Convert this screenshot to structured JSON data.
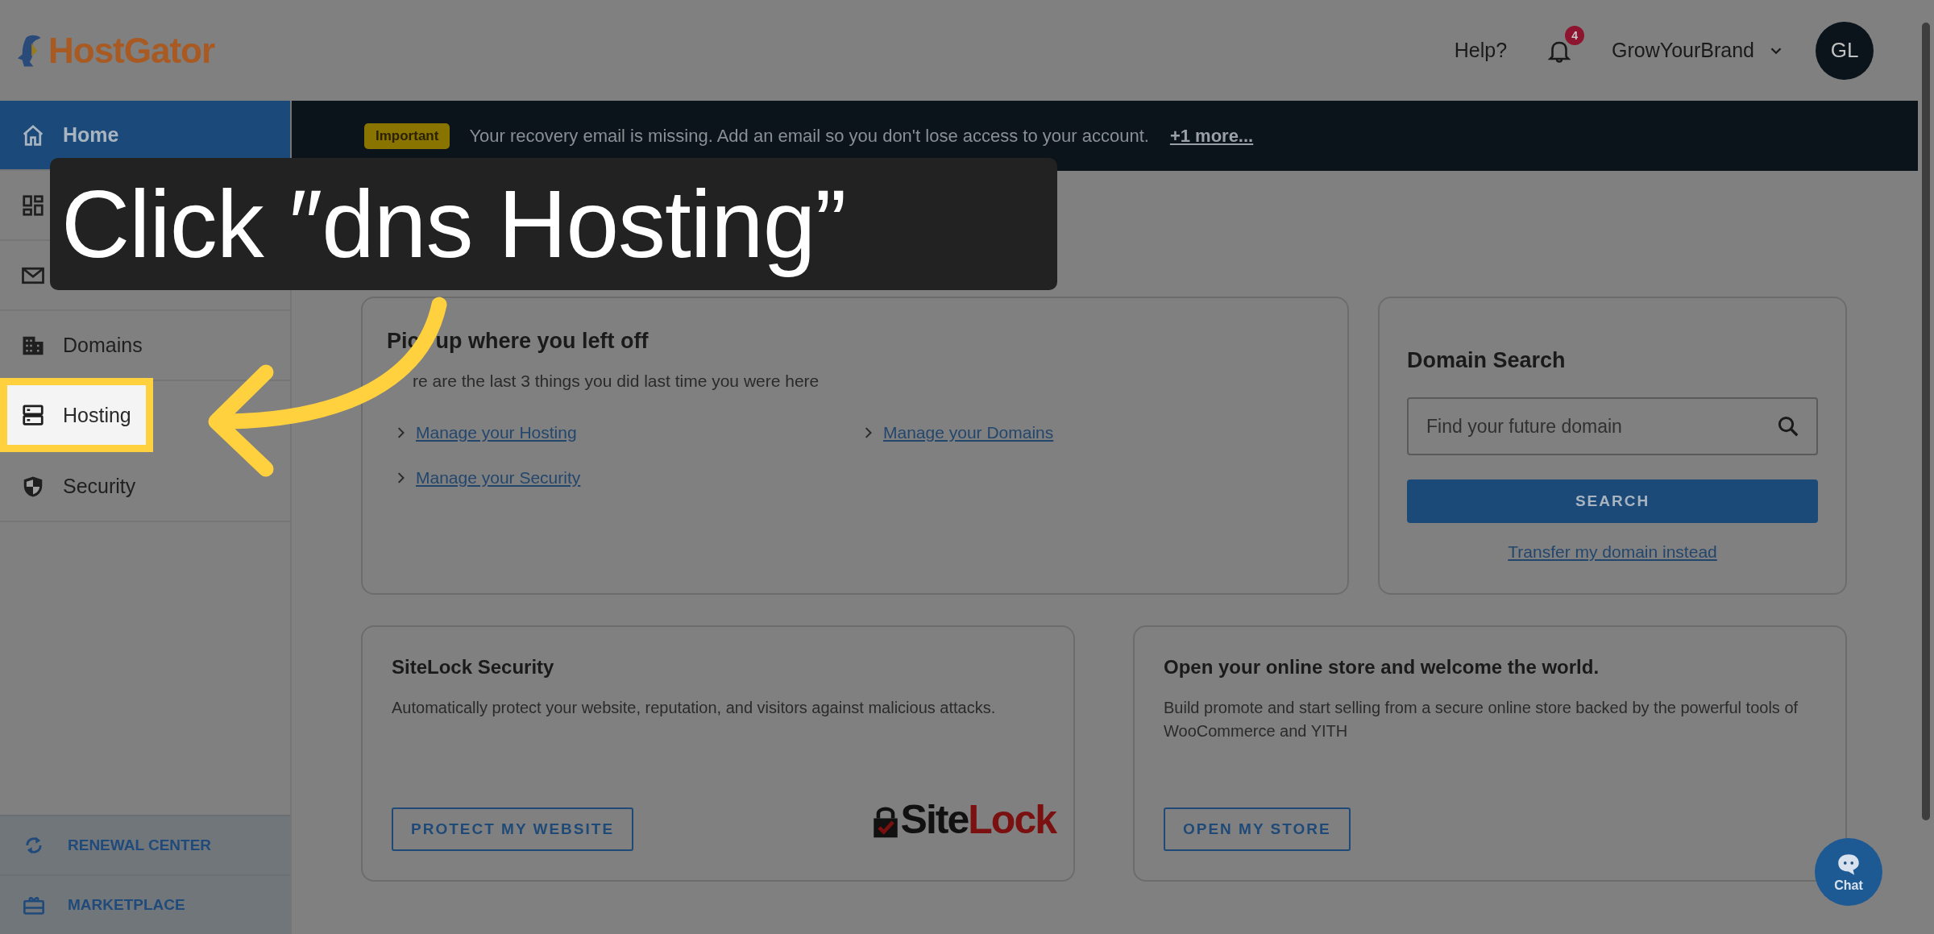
{
  "header": {
    "logo": "HostGator",
    "help": "Help?",
    "notifications": "4",
    "account": "GrowYourBrand",
    "avatar": "GL"
  },
  "sidebar": {
    "items": [
      {
        "label": "Home",
        "selected": true,
        "highlighted": false
      },
      {
        "selected": false,
        "highlighted": false
      },
      {
        "selected": false,
        "highlighted": false
      },
      {
        "label": "Domains",
        "selected": false,
        "highlighted": false
      },
      {
        "label": "Hosting",
        "selected": false,
        "highlighted": true
      },
      {
        "label": "Security",
        "selected": false,
        "highlighted": false
      }
    ],
    "footer_items": [
      {
        "label": "RENEWAL CENTER"
      },
      {
        "label": "MARKETPLACE"
      }
    ]
  },
  "banner": {
    "badge": "Important",
    "message": "Your recovery email is missing. Add an email so you don't lose access to your account.",
    "more": "+1 more..."
  },
  "recent": {
    "title": [
      "Pic",
      "up where you left off"
    ],
    "subtitle": "re are the last 3 things you did last time you were here",
    "links": [
      "Manage your Hosting",
      "Manage your Domains",
      "Manage your Security"
    ]
  },
  "domain_search": {
    "title": "Domain Search",
    "placeholder": "Find your future domain",
    "button": "SEARCH",
    "link": "Transfer my domain instead"
  },
  "promos": [
    {
      "kind": "sitelock",
      "title": "SiteLock Security",
      "text": "Automatically protect your website, reputation, and visitors against malicious attacks.",
      "button": "PROTECT MY WEBSITE",
      "logo": [
        "Site",
        "Lock"
      ]
    },
    {
      "kind": "plain",
      "title": "Open your online store and welcome the world.",
      "text": "Build promote and start selling from a secure online store backed by the powerful tools of WooCommerce and YITH",
      "button": "OPEN MY STORE"
    }
  ],
  "chat": "Chat",
  "callout": {
    "text": "Click ″dns Hosting”"
  }
}
